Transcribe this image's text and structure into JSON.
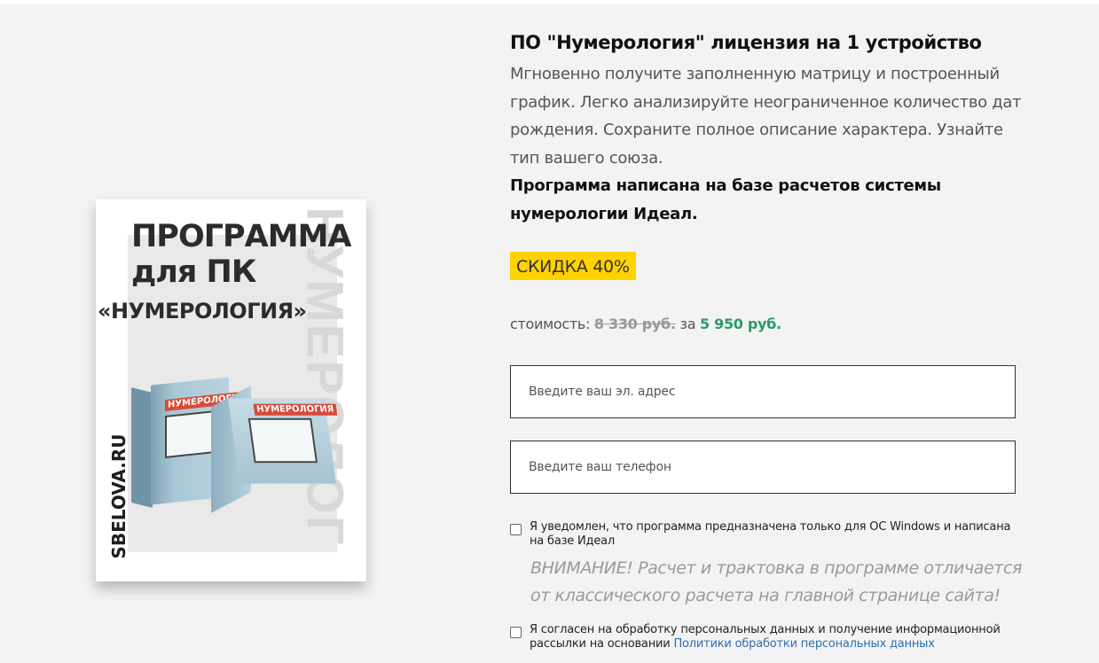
{
  "product_image": {
    "title_line1": "ПРОГРАММА",
    "title_line2": "для ПК",
    "subtitle": "«НУМЕРОЛОГИЯ»",
    "site": "SBELOVA.RU",
    "watermark": "НУМЕРОЛОГ",
    "box_label": "НУМЕРОЛОГИЯ"
  },
  "product": {
    "title": "ПО \"Нумерология\" лицензия на 1 устройство",
    "description": "Мгновенно получите заполненную матрицу и построенный график. Легко анализируйте неограниченное количество дат рождения. Сохраните полное описание характера. Узнайте тип вашего союза.",
    "description_bold": "Программа написана на базе расчетов системы нумерологии Идеал.",
    "discount": "СКИДКА 40%",
    "price_label": "стоимость:",
    "old_price": "8 330 руб.",
    "price_joiner": "за",
    "new_price": "5 950 руб."
  },
  "form": {
    "email_placeholder": "Введите ваш эл. адрес",
    "phone_placeholder": "Введите ваш телефон",
    "checkbox1_label": "Я уведомлен, что программа предназначена только для ОС Windows и написана на базе Идеал",
    "checkbox1_checked": false,
    "warning": "ВНИМАНИЕ! Расчет и трактовка в программе отличается от классического расчета на главной странице сайта!",
    "checkbox2_label": "Я согласен на обработку персональных данных и получение информационной рассылки на основании",
    "checkbox2_link": "Политики обработки персональных данных",
    "checkbox2_checked": false
  },
  "colors": {
    "accent_green": "#2a9a6b",
    "discount_yellow": "#ffd200",
    "link_blue": "#2f6fb0",
    "background": "#f3f3f3"
  }
}
